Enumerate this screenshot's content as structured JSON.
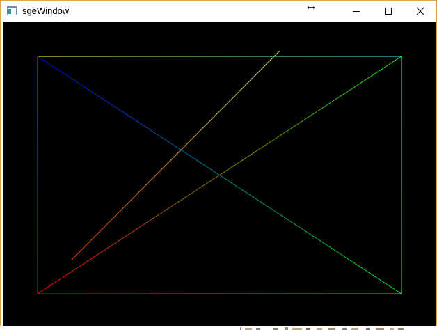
{
  "window": {
    "title": "sgeWindow",
    "icon": "app-window-icon",
    "controls": {
      "minimize_icon": "minimize-icon",
      "maximize_icon": "maximize-icon",
      "close_icon": "close-icon"
    },
    "border_color": "#e8a040"
  },
  "canvas": {
    "background": "#000000",
    "shapes": [
      {
        "name": "rectangle-top-edge",
        "colors": [
          "#ffff00",
          "#00ffff"
        ]
      },
      {
        "name": "rectangle-right-edge",
        "colors": [
          "#00ffff",
          "#00ff00"
        ]
      },
      {
        "name": "rectangle-bottom-edge",
        "colors": [
          "#ff0000",
          "#00ff00"
        ]
      },
      {
        "name": "rectangle-left-edge",
        "colors": [
          "#ff00ff",
          "#ff0000"
        ]
      },
      {
        "name": "diagonal-blue-green",
        "colors": [
          "#0000ff",
          "#00ff00"
        ]
      },
      {
        "name": "diagonal-red-green",
        "colors": [
          "#ff0000",
          "#00ff00"
        ]
      },
      {
        "name": "short-line-red-yellow",
        "colors": [
          "#ff4000",
          "#c0ff80"
        ]
      }
    ]
  }
}
